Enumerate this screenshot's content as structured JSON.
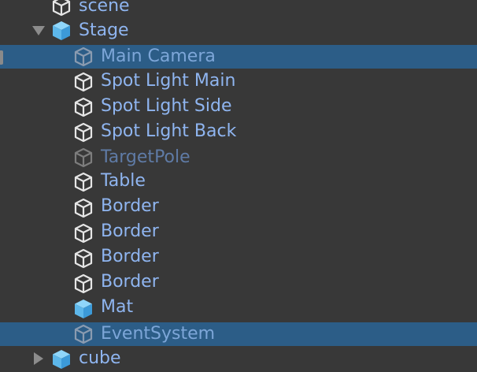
{
  "colors": {
    "background": "#383838",
    "selected_row": "#2C5D87",
    "label": "#8FB5F0",
    "label_inactive": "#5F7BA6",
    "prefab_icon": "#6EC6F5",
    "object_icon": "#E6E6E6",
    "object_icon_inactive": "#7D7D7D",
    "foldout_arrow": "#8C8C8C"
  },
  "items": [
    {
      "label": "scene",
      "icon": "gameobject-cube-icon",
      "selected": false,
      "active": true
    },
    {
      "label": "Stage",
      "icon": "prefab-cube-icon",
      "selected": false,
      "active": true,
      "expanded": true
    },
    {
      "label": "Main Camera",
      "icon": "gameobject-cube-icon",
      "selected": true,
      "active": true
    },
    {
      "label": "Spot Light Main",
      "icon": "gameobject-cube-icon",
      "selected": false,
      "active": true
    },
    {
      "label": "Spot Light Side",
      "icon": "gameobject-cube-icon",
      "selected": false,
      "active": true
    },
    {
      "label": "Spot Light Back",
      "icon": "gameobject-cube-icon",
      "selected": false,
      "active": true
    },
    {
      "label": "TargetPole",
      "icon": "gameobject-cube-icon",
      "selected": false,
      "active": false
    },
    {
      "label": "Table",
      "icon": "gameobject-cube-icon",
      "selected": false,
      "active": true
    },
    {
      "label": "Border",
      "icon": "gameobject-cube-icon",
      "selected": false,
      "active": true
    },
    {
      "label": "Border",
      "icon": "gameobject-cube-icon",
      "selected": false,
      "active": true
    },
    {
      "label": "Border",
      "icon": "gameobject-cube-icon",
      "selected": false,
      "active": true
    },
    {
      "label": "Border",
      "icon": "gameobject-cube-icon",
      "selected": false,
      "active": true
    },
    {
      "label": "Mat",
      "icon": "prefab-cube-icon",
      "selected": false,
      "active": true
    },
    {
      "label": "EventSystem",
      "icon": "gameobject-cube-icon",
      "selected": true,
      "active": true
    },
    {
      "label": "cube",
      "icon": "prefab-cube-icon",
      "selected": false,
      "active": true,
      "expanded": false
    }
  ]
}
